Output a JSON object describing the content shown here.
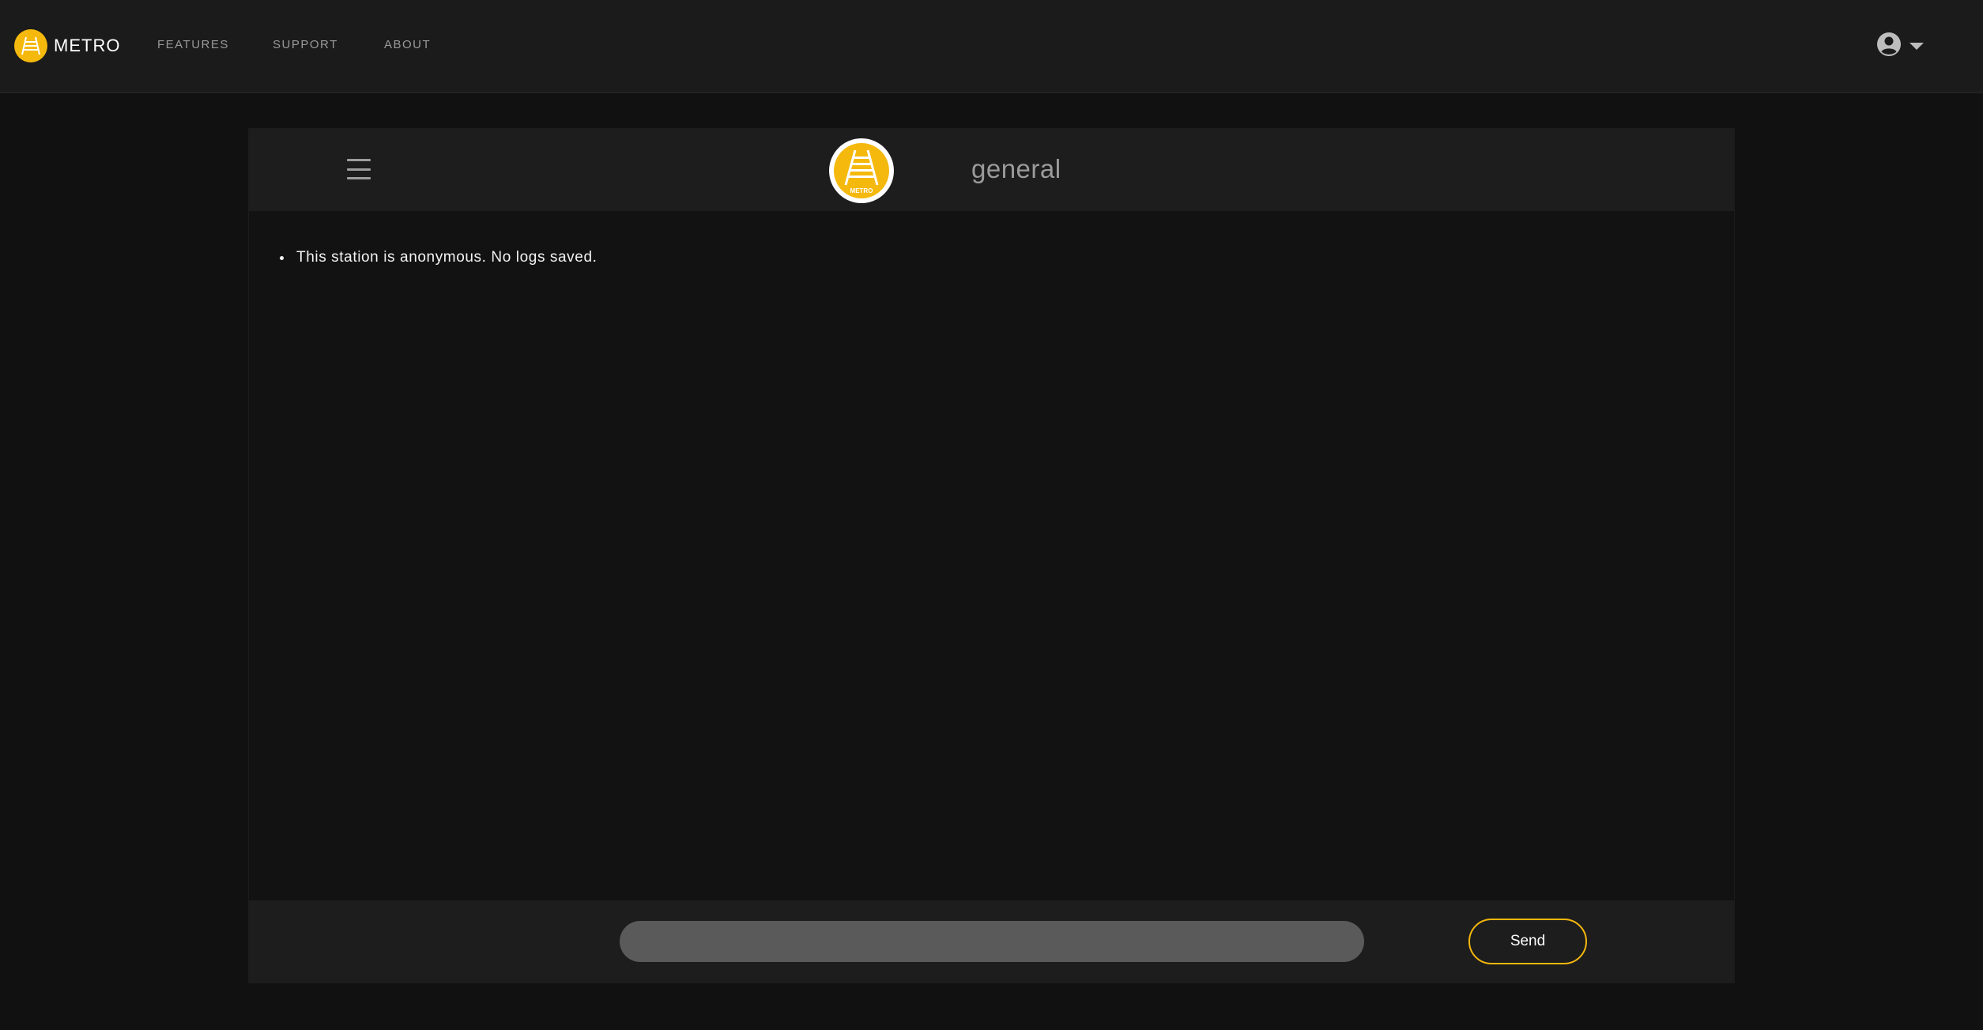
{
  "navbar": {
    "brand": "METRO",
    "links": [
      "FEATURES",
      "SUPPORT",
      "ABOUT"
    ]
  },
  "chat": {
    "channel_name": "general",
    "logo_label": "METRO",
    "messages": [
      "This station is anonymous. No logs saved."
    ],
    "input_value": "",
    "send_label": "Send"
  },
  "icons": {
    "brand_logo": "metro-track-icon",
    "user_menu": "user-circle-icon",
    "caret": "caret-down-icon",
    "menu_toggle": "hamburger-icon",
    "channel_logo": "metro-track-icon"
  },
  "colors": {
    "accent": "#f5b80d",
    "background": "#111111",
    "navbar": "#1b1b1b",
    "panel_bar": "#1d1d1d",
    "input": "#5a5a5a"
  }
}
